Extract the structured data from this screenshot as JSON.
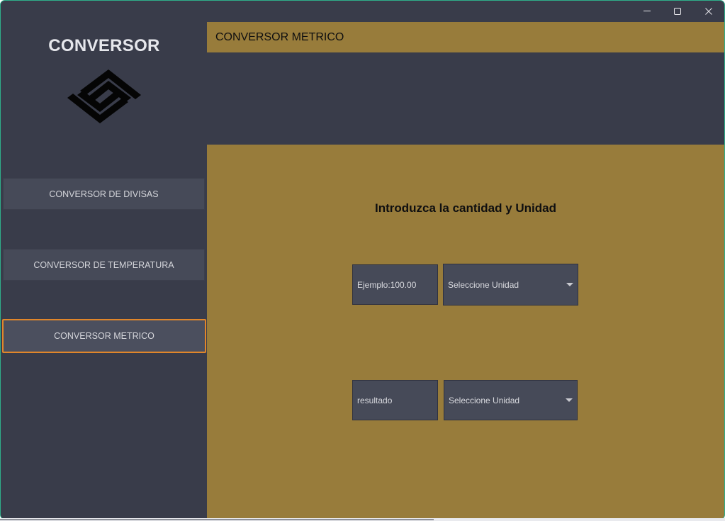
{
  "window": {
    "controls": {
      "minimize_icon": "minimize-icon",
      "maximize_icon": "maximize-icon",
      "close_icon": "close-icon"
    },
    "border_color": "#2fae8a"
  },
  "sidebar": {
    "title": "CONVERSOR",
    "logo_icon": "converter-logo-icon",
    "items": [
      {
        "label": "CONVERSOR DE DIVISAS",
        "selected": false
      },
      {
        "label": "CONVERSOR DE TEMPERATURA",
        "selected": false
      },
      {
        "label": "CONVERSOR METRICO",
        "selected": true
      }
    ],
    "selection_color": "#e1862a"
  },
  "main": {
    "header_title": "CONVERSOR METRICO",
    "prompt": "Introduzca la cantidad y Unidad",
    "amount_input": {
      "placeholder": "Ejemplo:100.00",
      "value": ""
    },
    "from_unit": {
      "selected": "Seleccione Unidad"
    },
    "result_field": {
      "text": "resultado"
    },
    "to_unit": {
      "selected": "Seleccione Unidad"
    },
    "accent_color": "#987c3b",
    "background_color": "#393c4a"
  }
}
